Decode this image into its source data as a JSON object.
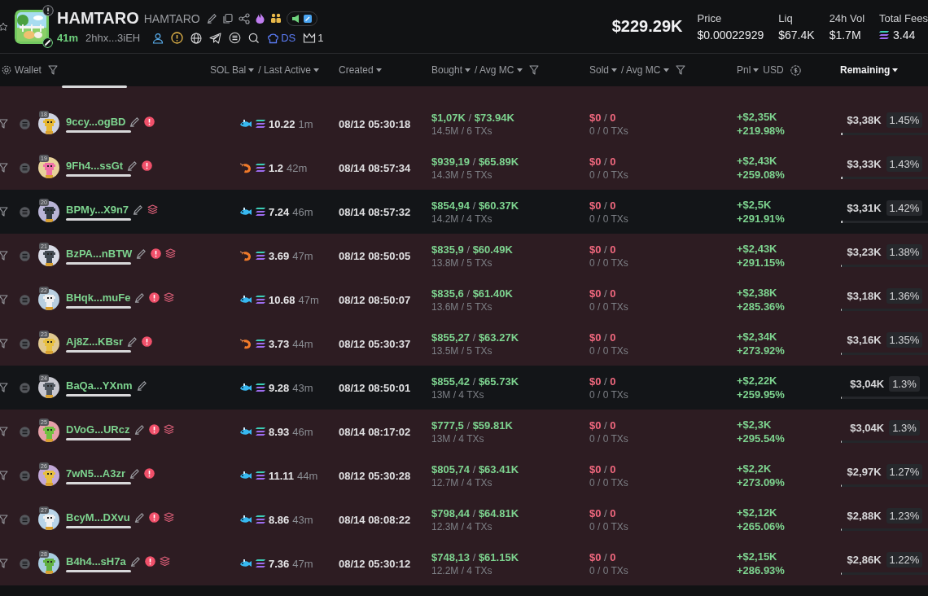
{
  "token": {
    "name": "HAMTARO",
    "ticker": "HAMTARO",
    "age": "41m",
    "address": "2hhx...3iEH",
    "ds_label": "DS",
    "crown_count": "1"
  },
  "market_cap": "$229.29K",
  "stats": [
    {
      "label": "Price",
      "value": "$0.00022929",
      "kind": "plain"
    },
    {
      "label": "Liq",
      "value": "$67.4K",
      "kind": "plain"
    },
    {
      "label": "24h Vol",
      "value": "$1.7M",
      "kind": "plain"
    },
    {
      "label": "Total Fees",
      "value": "3.44",
      "kind": "sol"
    }
  ],
  "columns": [
    {
      "label": "Wallet",
      "caret": false,
      "filter": true,
      "coin": false,
      "selected": false,
      "kind": "wallet"
    },
    {
      "label": "SOL Bal",
      "caret": true,
      "filter": false,
      "coin": false,
      "selected": false,
      "kind": "plain"
    },
    {
      "label": "/ Last Active",
      "caret": true,
      "filter": false,
      "coin": false,
      "selected": false,
      "kind": "plain"
    },
    {
      "label": "Created",
      "caret": true,
      "filter": false,
      "coin": false,
      "selected": false,
      "kind": "plain"
    },
    {
      "label": "Bought",
      "caret": true,
      "filter": false,
      "coin": false,
      "selected": false,
      "kind": "plain"
    },
    {
      "label": "/ Avg MC",
      "caret": true,
      "filter": true,
      "coin": false,
      "selected": false,
      "kind": "plain"
    },
    {
      "label": "Sold",
      "caret": true,
      "filter": false,
      "coin": false,
      "selected": false,
      "kind": "plain"
    },
    {
      "label": "/ Avg MC",
      "caret": true,
      "filter": true,
      "coin": false,
      "selected": false,
      "kind": "plain"
    },
    {
      "label": "Pnl",
      "caret": true,
      "filter": false,
      "coin": false,
      "selected": false,
      "kind": "plain"
    },
    {
      "label": "USD",
      "caret": false,
      "filter": false,
      "coin": true,
      "selected": false,
      "kind": "plain"
    },
    {
      "label": "Remaining",
      "caret": true,
      "filter": false,
      "coin": false,
      "selected": true,
      "kind": "plain"
    }
  ],
  "rows": [
    {
      "rank": "18",
      "wallet": "9ccy...ogBD",
      "alert": true,
      "bundled": false,
      "shrimp": false,
      "sol": "10.22",
      "active": "1m",
      "created": "08/12 05:30:18",
      "bought": "$1,07K",
      "bought_sep": "/",
      "bought_mc": "$73.94K",
      "bought_sub": "14.5M / 6 TXs",
      "sold": "$0",
      "sold_sep": "/",
      "sold_mc": "0",
      "sold_sub": "0 / 0 TXs",
      "pnl": "+$2,35K",
      "pnl_pct": "+219.98%",
      "remaining": "$3,38K",
      "remaining_pct": "1.45%",
      "level": 0.0145
    },
    {
      "rank": "19",
      "wallet": "9Fh4...ssGt",
      "alert": true,
      "bundled": false,
      "shrimp": true,
      "sol": "1.2",
      "active": "42m",
      "created": "08/14 08:57:34",
      "bought": "$939,19",
      "bought_sep": "/",
      "bought_mc": "$65.89K",
      "bought_sub": "14.3M / 5 TXs",
      "sold": "$0",
      "sold_sep": "/",
      "sold_mc": "0",
      "sold_sub": "0 / 0 TXs",
      "pnl": "+$2,43K",
      "pnl_pct": "+259.08%",
      "remaining": "$3,33K",
      "remaining_pct": "1.43%",
      "level": 0.0143
    },
    {
      "rank": "20",
      "wallet": "BPMy...X9n7",
      "alert": false,
      "bundled": true,
      "shrimp": false,
      "sol": "7.24",
      "active": "46m",
      "created": "08/14 08:57:32",
      "bought": "$854,94",
      "bought_sep": "/",
      "bought_mc": "$60.37K",
      "bought_sub": "14.2M / 4 TXs",
      "sold": "$0",
      "sold_sep": "/",
      "sold_mc": "0",
      "sold_sub": "0 / 0 TXs",
      "pnl": "+$2,5K",
      "pnl_pct": "+291.91%",
      "remaining": "$3,31K",
      "remaining_pct": "1.42%",
      "level": 0.0142
    },
    {
      "rank": "21",
      "wallet": "BzPA...nBTW",
      "alert": true,
      "bundled": true,
      "shrimp": true,
      "sol": "3.69",
      "active": "47m",
      "created": "08/12 08:50:05",
      "bought": "$835,9",
      "bought_sep": "/",
      "bought_mc": "$60.49K",
      "bought_sub": "13.8M / 5 TXs",
      "sold": "$0",
      "sold_sep": "/",
      "sold_mc": "0",
      "sold_sub": "0 / 0 TXs",
      "pnl": "+$2,43K",
      "pnl_pct": "+291.15%",
      "remaining": "$3,23K",
      "remaining_pct": "1.38%",
      "level": 0.0138
    },
    {
      "rank": "22",
      "wallet": "BHqk...muFe",
      "alert": true,
      "bundled": true,
      "shrimp": false,
      "sol": "10.68",
      "active": "47m",
      "created": "08/12 08:50:07",
      "bought": "$835,6",
      "bought_sep": "/",
      "bought_mc": "$61.40K",
      "bought_sub": "13.6M / 5 TXs",
      "sold": "$0",
      "sold_sep": "/",
      "sold_mc": "0",
      "sold_sub": "0 / 0 TXs",
      "pnl": "+$2,38K",
      "pnl_pct": "+285.36%",
      "remaining": "$3,18K",
      "remaining_pct": "1.36%",
      "level": 0.0136
    },
    {
      "rank": "23",
      "wallet": "Aj8Z...KBsr",
      "alert": true,
      "bundled": false,
      "shrimp": true,
      "sol": "3.73",
      "active": "44m",
      "created": "08/12 05:30:37",
      "bought": "$855,27",
      "bought_sep": "/",
      "bought_mc": "$63.27K",
      "bought_sub": "13.5M / 5 TXs",
      "sold": "$0",
      "sold_sep": "/",
      "sold_mc": "0",
      "sold_sub": "0 / 0 TXs",
      "pnl": "+$2,34K",
      "pnl_pct": "+273.92%",
      "remaining": "$3,16K",
      "remaining_pct": "1.35%",
      "level": 0.0135
    },
    {
      "rank": "24",
      "wallet": "BaQa...YXnm",
      "alert": false,
      "bundled": false,
      "shrimp": false,
      "sol": "9.28",
      "active": "43m",
      "created": "08/12 08:50:01",
      "bought": "$855,42",
      "bought_sep": "/",
      "bought_mc": "$65.73K",
      "bought_sub": "13M / 4 TXs",
      "sold": "$0",
      "sold_sep": "/",
      "sold_mc": "0",
      "sold_sub": "0 / 0 TXs",
      "pnl": "+$2,22K",
      "pnl_pct": "+259.95%",
      "remaining": "$3,04K",
      "remaining_pct": "1.3%",
      "level": 0.013
    },
    {
      "rank": "25",
      "wallet": "DVoG...URcz",
      "alert": true,
      "bundled": true,
      "shrimp": false,
      "sol": "8.93",
      "active": "46m",
      "created": "08/14 08:17:02",
      "bought": "$777,5",
      "bought_sep": "/",
      "bought_mc": "$59.81K",
      "bought_sub": "13M / 4 TXs",
      "sold": "$0",
      "sold_sep": "/",
      "sold_mc": "0",
      "sold_sub": "0 / 0 TXs",
      "pnl": "+$2,3K",
      "pnl_pct": "+295.54%",
      "remaining": "$3,04K",
      "remaining_pct": "1.3%",
      "level": 0.013
    },
    {
      "rank": "26",
      "wallet": "7wN5...A3zr",
      "alert": true,
      "bundled": false,
      "shrimp": false,
      "sol": "11.11",
      "active": "44m",
      "created": "08/12 05:30:28",
      "bought": "$805,74",
      "bought_sep": "/",
      "bought_mc": "$63.41K",
      "bought_sub": "12.7M / 4 TXs",
      "sold": "$0",
      "sold_sep": "/",
      "sold_mc": "0",
      "sold_sub": "0 / 0 TXs",
      "pnl": "+$2,2K",
      "pnl_pct": "+273.09%",
      "remaining": "$2,97K",
      "remaining_pct": "1.27%",
      "level": 0.0127
    },
    {
      "rank": "27",
      "wallet": "BcyM...DXvu",
      "alert": true,
      "bundled": true,
      "shrimp": false,
      "sol": "8.86",
      "active": "43m",
      "created": "08/14 08:08:22",
      "bought": "$798,44",
      "bought_sep": "/",
      "bought_mc": "$64.81K",
      "bought_sub": "12.3M / 4 TXs",
      "sold": "$0",
      "sold_sep": "/",
      "sold_mc": "0",
      "sold_sub": "0 / 0 TXs",
      "pnl": "+$2,12K",
      "pnl_pct": "+265.06%",
      "remaining": "$2,88K",
      "remaining_pct": "1.23%",
      "level": 0.0123
    },
    {
      "rank": "28",
      "wallet": "B4h4...sH7a",
      "alert": true,
      "bundled": true,
      "shrimp": false,
      "sol": "7.36",
      "active": "47m",
      "created": "08/12 05:30:12",
      "bought": "$748,13",
      "bought_sep": "/",
      "bought_mc": "$61.15K",
      "bought_sub": "12.2M / 4 TXs",
      "sold": "$0",
      "sold_sep": "/",
      "sold_mc": "0",
      "sold_sub": "0 / 0 TXs",
      "pnl": "+$2,15K",
      "pnl_pct": "+286.93%",
      "remaining": "$2,86K",
      "remaining_pct": "1.22%",
      "level": 0.0122
    }
  ]
}
